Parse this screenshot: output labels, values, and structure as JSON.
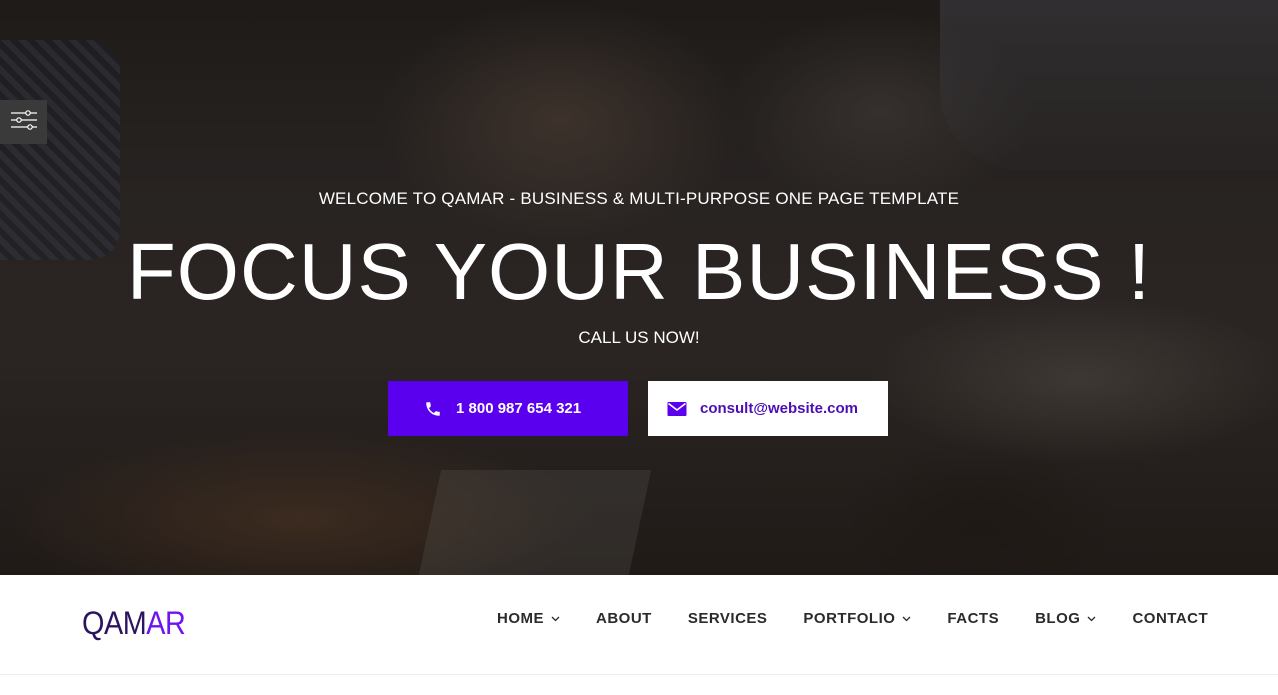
{
  "hero": {
    "subtitle": "WELCOME TO QAMAR - BUSINESS & MULTI-PURPOSE ONE PAGE TEMPLATE",
    "title": "FOCUS YOUR BUSINESS !",
    "cta_text": "CALL US NOW!",
    "phone_button": {
      "label": "1 800 987 654 321",
      "icon": "phone-icon"
    },
    "email_button": {
      "label": "consult@website.com",
      "icon": "envelope-icon"
    }
  },
  "settings": {
    "icon": "sliders-icon"
  },
  "navbar": {
    "logo": {
      "part1": "QAM",
      "part2": "AR"
    },
    "items": [
      {
        "label": "HOME",
        "dropdown": true
      },
      {
        "label": "ABOUT",
        "dropdown": false
      },
      {
        "label": "SERVICES",
        "dropdown": false
      },
      {
        "label": "PORTFOLIO",
        "dropdown": true
      },
      {
        "label": "FACTS",
        "dropdown": false
      },
      {
        "label": "BLOG",
        "dropdown": true
      },
      {
        "label": "CONTACT",
        "dropdown": false
      }
    ]
  },
  "colors": {
    "accent": "#5b00ee",
    "logo_dark": "#2c145f",
    "logo_light": "#6d14f0",
    "email_text": "#4b0fb5",
    "nav_text": "#2b2b2b"
  }
}
